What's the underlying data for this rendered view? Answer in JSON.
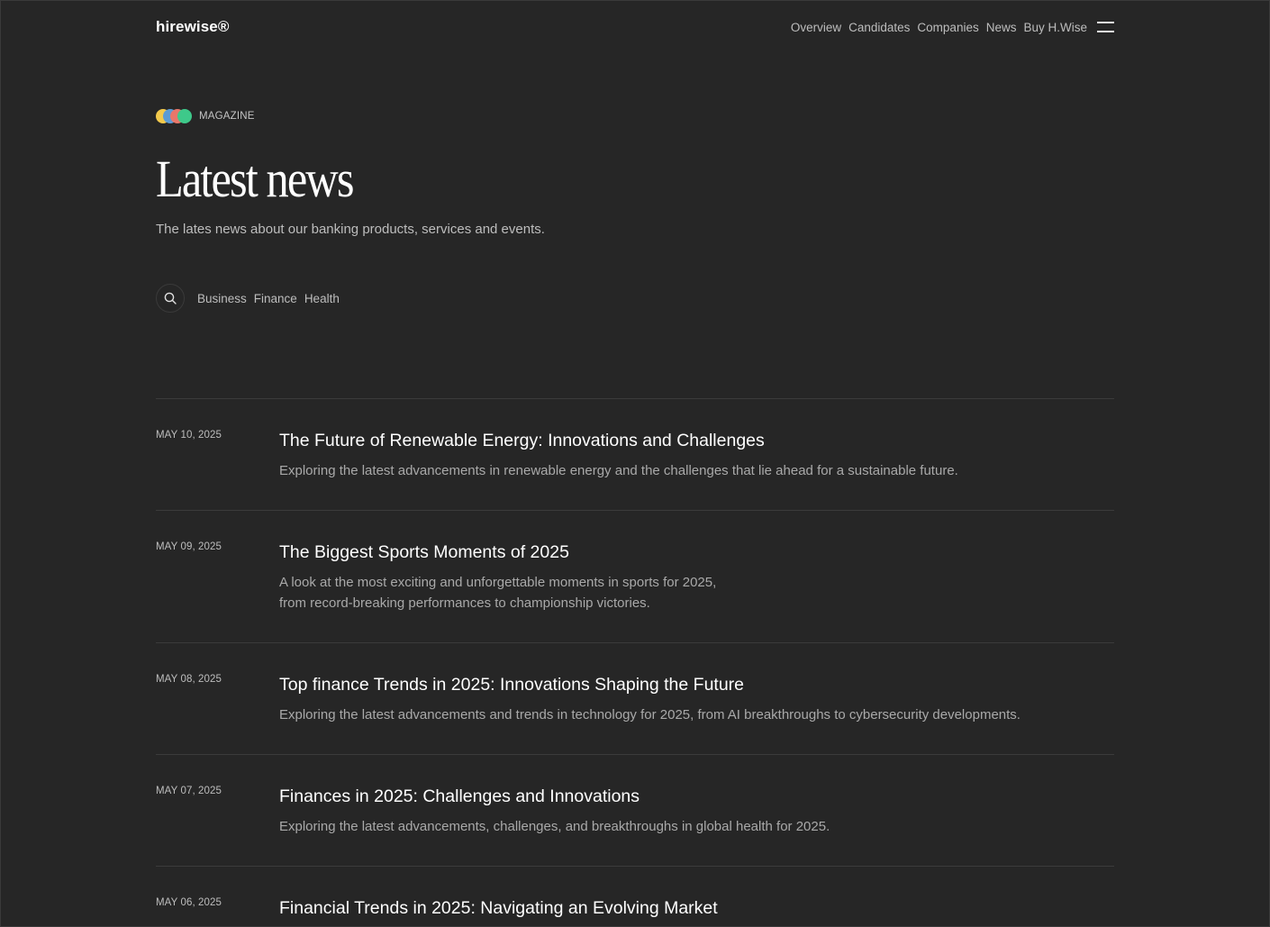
{
  "brand": {
    "logo": "hirewise®"
  },
  "nav": {
    "items": [
      "Overview",
      "Candidates",
      "Companies",
      "News",
      "Buy H.Wise"
    ],
    "menu_icon": "hamburger-menu-icon"
  },
  "hero": {
    "tag": "MAGAZINE",
    "tag_dot_colors": [
      "#f2c94c",
      "#5b9bd5",
      "#e8776a",
      "#3ec98a"
    ],
    "title": "Latest news",
    "subtitle": "The lates news about our banking products, services and events."
  },
  "filters": {
    "search_icon": "search-icon",
    "categories": [
      "Business",
      "Finance",
      "Health"
    ]
  },
  "news": [
    {
      "date": "MAY 10, 2025",
      "title": "The Future of Renewable Energy: Innovations and Challenges",
      "description": "Exploring the latest advancements in renewable energy and the challenges that lie ahead for a sustainable future."
    },
    {
      "date": "MAY 09, 2025",
      "title": "The Biggest Sports Moments of 2025",
      "description": "A look at the most exciting and unforgettable moments in sports for 2025, from record-breaking performances to championship victories."
    },
    {
      "date": "MAY 08, 2025",
      "title": "Top finance Trends in 2025: Innovations Shaping the Future",
      "description": "Exploring the latest advancements and trends in technology for 2025, from AI breakthroughs to cybersecurity developments."
    },
    {
      "date": "MAY 07, 2025",
      "title": "Finances in 2025: Challenges and Innovations",
      "description": "Exploring the latest advancements, challenges, and breakthroughs in global health for 2025."
    },
    {
      "date": "MAY 06, 2025",
      "title": "Financial Trends in 2025: Navigating an Evolving Market",
      "description": ""
    }
  ]
}
